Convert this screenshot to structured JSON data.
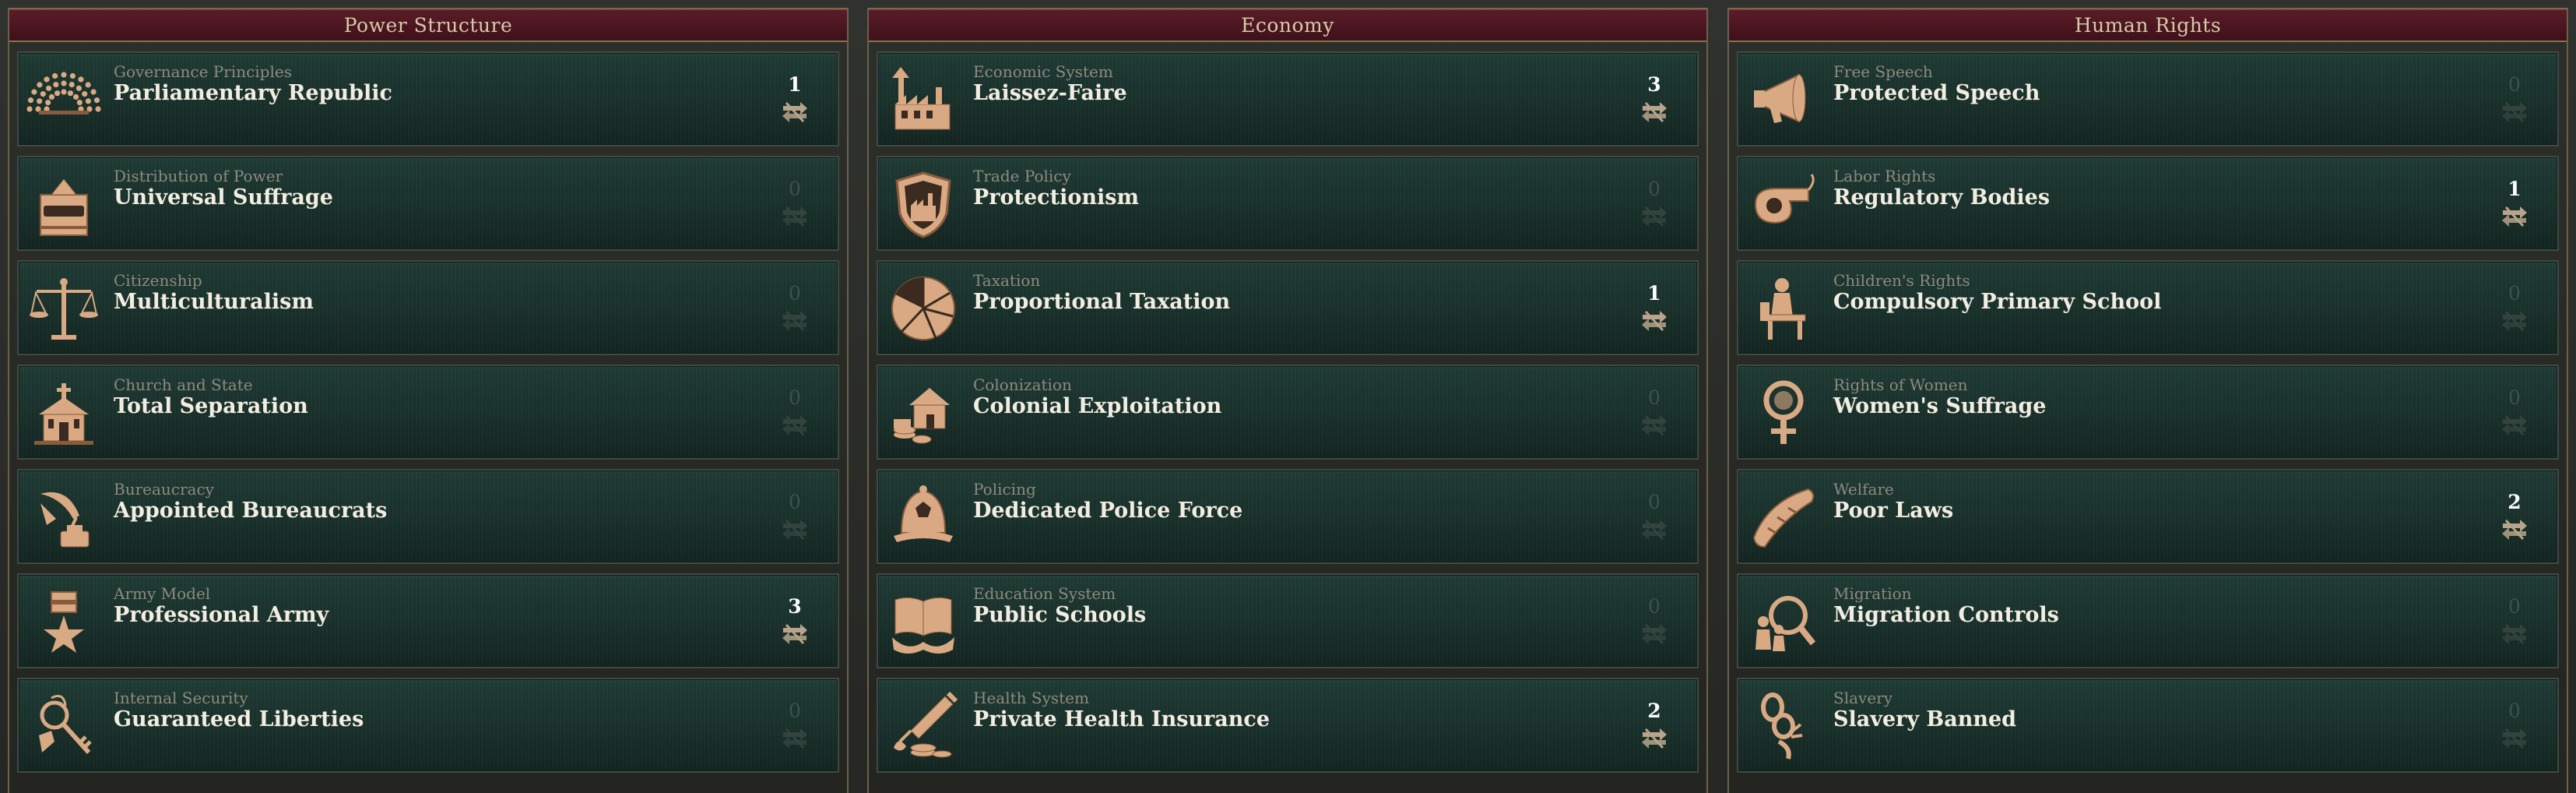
{
  "panels": [
    {
      "title": "Power Structure",
      "laws": [
        {
          "category": "Governance Principles",
          "name": "Parliamentary Republic",
          "count": "1",
          "icon": "parliament-icon"
        },
        {
          "category": "Distribution of Power",
          "name": "Universal Suffrage",
          "count": "0",
          "icon": "ballot-box-icon"
        },
        {
          "category": "Citizenship",
          "name": "Multiculturalism",
          "count": "0",
          "icon": "scales-icon"
        },
        {
          "category": "Church and State",
          "name": "Total Separation",
          "count": "0",
          "icon": "church-icon"
        },
        {
          "category": "Bureaucracy",
          "name": "Appointed Bureaucrats",
          "count": "0",
          "icon": "quill-inkwell-icon"
        },
        {
          "category": "Army Model",
          "name": "Professional Army",
          "count": "3",
          "icon": "medal-icon"
        },
        {
          "category": "Internal Security",
          "name": "Guaranteed Liberties",
          "count": "0",
          "icon": "key-icon"
        }
      ]
    },
    {
      "title": "Economy",
      "laws": [
        {
          "category": "Economic System",
          "name": "Laissez-Faire",
          "count": "3",
          "icon": "factory-growth-icon"
        },
        {
          "category": "Trade Policy",
          "name": "Protectionism",
          "count": "0",
          "icon": "shield-factory-icon"
        },
        {
          "category": "Taxation",
          "name": "Proportional Taxation",
          "count": "1",
          "icon": "pie-icon"
        },
        {
          "category": "Colonization",
          "name": "Colonial Exploitation",
          "count": "0",
          "icon": "colonial-house-icon"
        },
        {
          "category": "Policing",
          "name": "Dedicated Police Force",
          "count": "0",
          "icon": "police-helmet-icon"
        },
        {
          "category": "Education System",
          "name": "Public Schools",
          "count": "0",
          "icon": "book-hands-icon"
        },
        {
          "category": "Health System",
          "name": "Private Health Insurance",
          "count": "2",
          "icon": "syringe-coins-icon"
        }
      ]
    },
    {
      "title": "Human Rights",
      "laws": [
        {
          "category": "Free Speech",
          "name": "Protected Speech",
          "count": "0",
          "icon": "megaphone-icon"
        },
        {
          "category": "Labor Rights",
          "name": "Regulatory Bodies",
          "count": "1",
          "icon": "whistle-icon"
        },
        {
          "category": "Children's Rights",
          "name": "Compulsory Primary School",
          "count": "0",
          "icon": "school-desk-icon"
        },
        {
          "category": "Rights of Women",
          "name": "Women's Suffrage",
          "count": "0",
          "icon": "venus-icon"
        },
        {
          "category": "Welfare",
          "name": "Poor Laws",
          "count": "2",
          "icon": "bread-icon"
        },
        {
          "category": "Migration",
          "name": "Migration Controls",
          "count": "0",
          "icon": "magnifier-people-icon"
        },
        {
          "category": "Slavery",
          "name": "Slavery Banned",
          "count": "0",
          "icon": "broken-chain-icon"
        }
      ]
    }
  ],
  "colors": {
    "header": "#4a1520",
    "card": "#1b332e",
    "icon": "#d8a983",
    "active_count": "#ffffff",
    "inactive_count": "#3e504a"
  }
}
